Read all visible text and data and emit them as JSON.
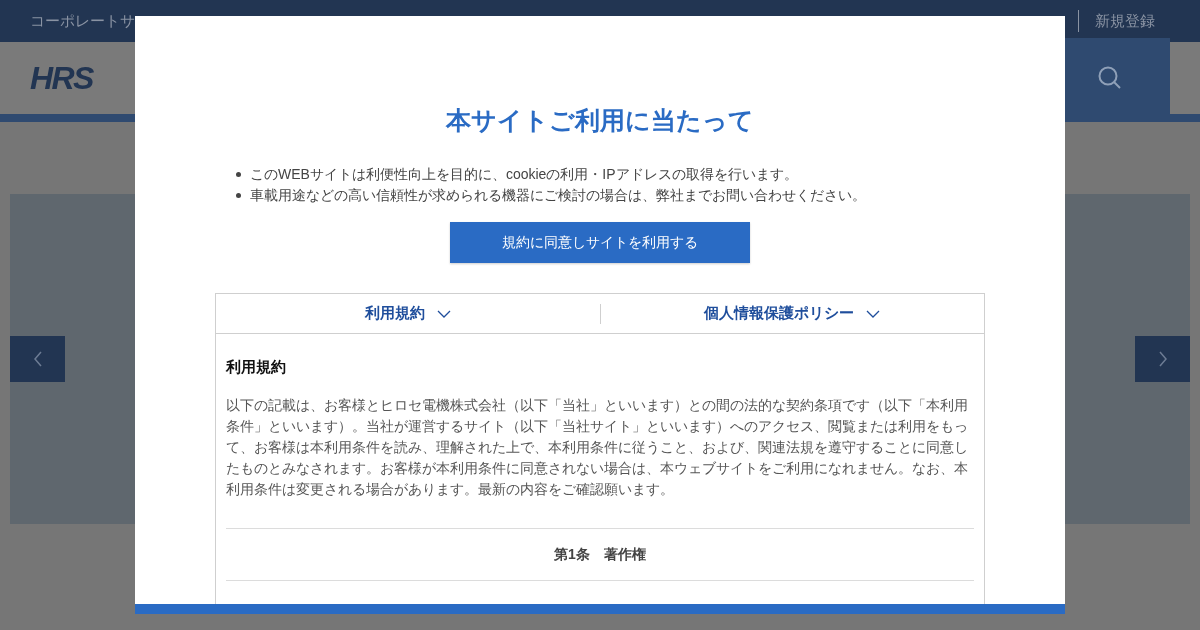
{
  "top_bar": {
    "left_link": "コーポレートサ",
    "right_link": "新規登録"
  },
  "header": {
    "logo": "HRS"
  },
  "modal": {
    "title": "本サイトご利用に当たって",
    "notices": [
      "このWEBサイトは利便性向上を目的に、cookieの利用・IPアドレスの取得を行います。",
      "車載用途などの高い信頼性が求められる機器にご検討の場合は、弊社までお問い合わせください。"
    ],
    "agree_button": "規約に同意しサイトを利用する",
    "tabs": [
      {
        "label": "利用規約"
      },
      {
        "label": "個人情報保護ポリシー"
      }
    ],
    "content": {
      "heading": "利用規約",
      "paragraph": "以下の記載は、お客様とヒロセ電機株式会社（以下「当社」といいます）との間の法的な契約条項です（以下「本利用条件」といいます）。当社が運営するサイト（以下「当社サイト」といいます）へのアクセス、閲覧または利用をもって、お客様は本利用条件を読み、理解された上で、本利用条件に従うこと、および、関連法規を遵守することに同意したものとみなされます。お客様が本利用条件に同意されない場合は、本ウェブサイトをご利用になれません。なお、本利用条件は変更される場合があります。最新の内容をご確認願います。",
      "article": "第1条　著作権"
    }
  }
}
